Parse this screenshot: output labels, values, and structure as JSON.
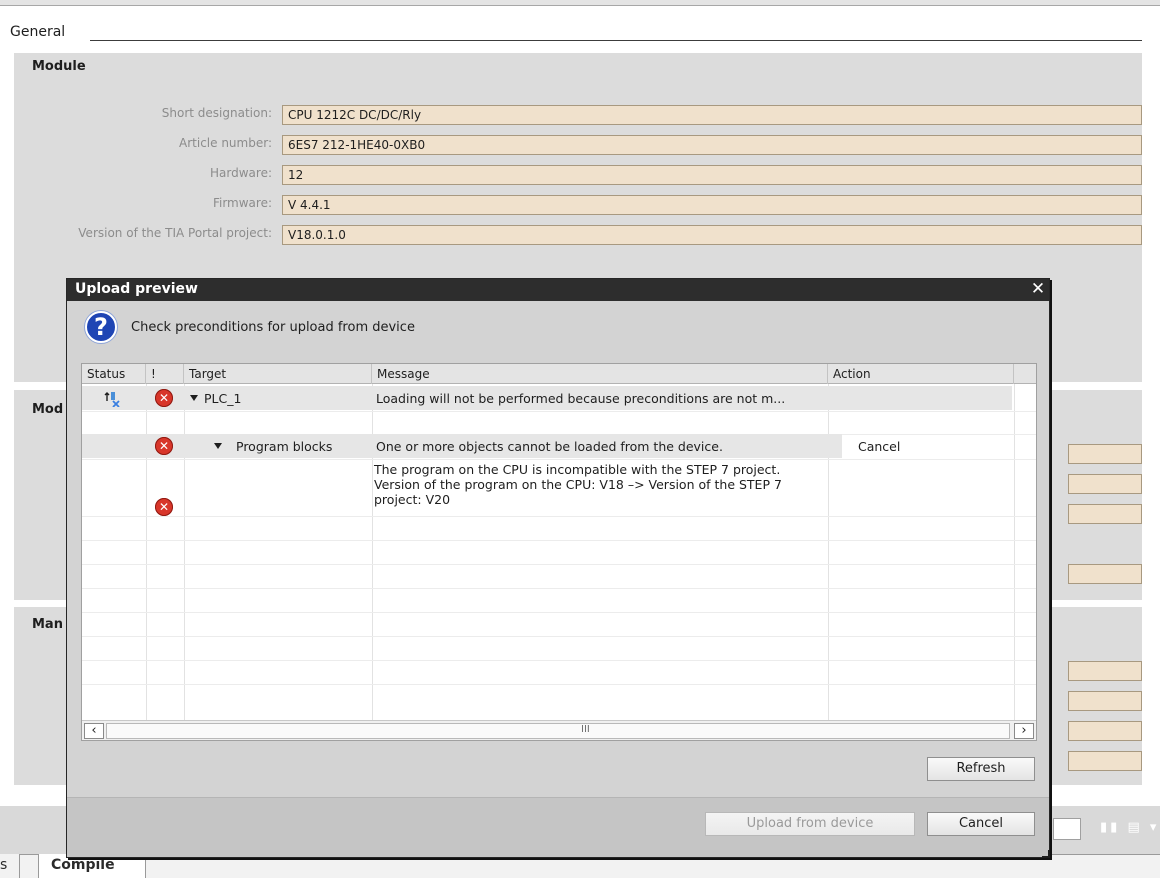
{
  "section": {
    "title": "General"
  },
  "module_panel": {
    "title": "Module",
    "rows": [
      {
        "label": "Short designation:",
        "value": "CPU 1212C DC/DC/Rly"
      },
      {
        "label": "Article number:",
        "value": "6ES7 212-1HE40-0XB0"
      },
      {
        "label": "Hardware:",
        "value": "12"
      },
      {
        "label": "Firmware:",
        "value": "V 4.4.1"
      },
      {
        "label": "Version of the TIA Portal project:",
        "value": "V18.0.1.0"
      }
    ]
  },
  "panel2": {
    "title": "Mod"
  },
  "panel3": {
    "title": "Man"
  },
  "bottom_tabs": {
    "tab1": "s",
    "tab2": "Compile"
  },
  "dialog": {
    "title": "Upload preview",
    "instruction": "Check preconditions for upload from device",
    "columns": {
      "status": "Status",
      "excl": "!",
      "target": "Target",
      "message": "Message",
      "action": "Action"
    },
    "rows": [
      {
        "target": "PLC_1",
        "message": "Loading will not be performed because preconditions are not m...",
        "action": ""
      },
      {
        "target": "Program blocks",
        "message": "One or more objects cannot be loaded from the device.",
        "action": "Cancel"
      },
      {
        "target": "",
        "message": "The program on the CPU is incompatible with the STEP 7 project. Version of the program on the CPU: V18 –> Version of the STEP 7 project: V20",
        "action": ""
      }
    ],
    "scroll_grip": "III",
    "refresh_label": "Refresh",
    "upload_label": "Upload from device",
    "cancel_label": "Cancel",
    "close_icon": "close-icon",
    "accent": "#1f45b4",
    "error_color": "#d8362a"
  }
}
